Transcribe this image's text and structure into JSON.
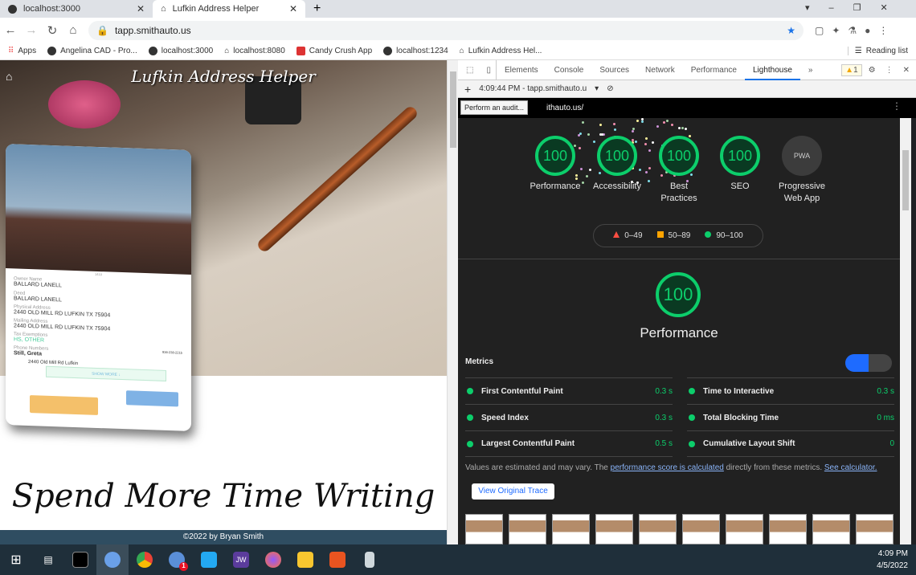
{
  "browser": {
    "tabs": [
      {
        "label": "localhost:3000",
        "icon": "triangle-circle-icon"
      },
      {
        "label": "Lufkin Address Helper",
        "icon": "house-icon",
        "active": true
      }
    ],
    "new_tab": "+",
    "url": "tapp.smithauto.us",
    "bookmarks": [
      "Apps",
      "Angelina CAD - Pro...",
      "localhost:3000",
      "localhost:8080",
      "Candy Crush App",
      "localhost:1234",
      "Lufkin Address Hel..."
    ],
    "reading_list": "Reading list"
  },
  "page": {
    "title": "Lufkin Address Helper",
    "phone": {
      "caption": "1410",
      "fields": [
        {
          "label": "Owner Name",
          "value": "BALLARD LANELL"
        },
        {
          "label": "Deed",
          "value": "BALLARD LANELL"
        },
        {
          "label": "Physical Address",
          "value": "2440 OLD MILL RD LUFKIN TX 75904"
        },
        {
          "label": "Mailing Address",
          "value": "2440 OLD MILL RD LUFKIN TX 75904"
        },
        {
          "label": "Tax Exemptions",
          "value": "HS, OTHER"
        },
        {
          "label": "Phone Numbers",
          "value": "Still, Greta"
        }
      ],
      "phone_address": "2440 Old Mill Rd Lufkin",
      "phone_number": "936-238-2215",
      "show_more": "SHOW MORE ↓"
    },
    "slogan": "Spend More Time Writing",
    "footer": "©2022 by Bryan Smith"
  },
  "devtools": {
    "tabs": [
      "Elements",
      "Console",
      "Sources",
      "Network",
      "Performance",
      "Lighthouse"
    ],
    "active_tab": "Lighthouse",
    "more": "»",
    "warnings": "1",
    "report_select": "4:09:44 PM - tapp.smithauto.u",
    "report_url": "ithauto.us/",
    "tooltip": "Perform an audit...",
    "scores": [
      {
        "label": "Performance",
        "value": "100"
      },
      {
        "label": "Accessibility",
        "value": "100"
      },
      {
        "label": "Best Practices",
        "value": "100"
      },
      {
        "label": "SEO",
        "value": "100"
      },
      {
        "label": "Progressive Web App",
        "value": "PWA"
      }
    ],
    "legend": [
      "0–49",
      "50–89",
      "90–100"
    ],
    "colors": {
      "pass": "#0cce6b",
      "average": "#ffa400",
      "fail": "#ff4e42",
      "accent": "#1e6bff"
    },
    "perf_score": "100",
    "perf_title": "Performance",
    "metrics_title": "Metrics",
    "metrics": [
      {
        "name": "First Contentful Paint",
        "value": "0.3 s"
      },
      {
        "name": "Time to Interactive",
        "value": "0.3 s"
      },
      {
        "name": "Speed Index",
        "value": "0.3 s"
      },
      {
        "name": "Total Blocking Time",
        "value": "0 ms"
      },
      {
        "name": "Largest Contentful Paint",
        "value": "0.5 s"
      },
      {
        "name": "Cumulative Layout Shift",
        "value": "0"
      }
    ],
    "note_pre": "Values are estimated and may vary. The ",
    "note_link": "performance score is calculated",
    "note_mid": " directly from these metrics. ",
    "note_link2": "See calculator.",
    "trace_button": "View Original Trace"
  },
  "taskbar": {
    "time": "4:09 PM",
    "date": "4/5/2022",
    "badge": "1",
    "jw": "JW"
  }
}
